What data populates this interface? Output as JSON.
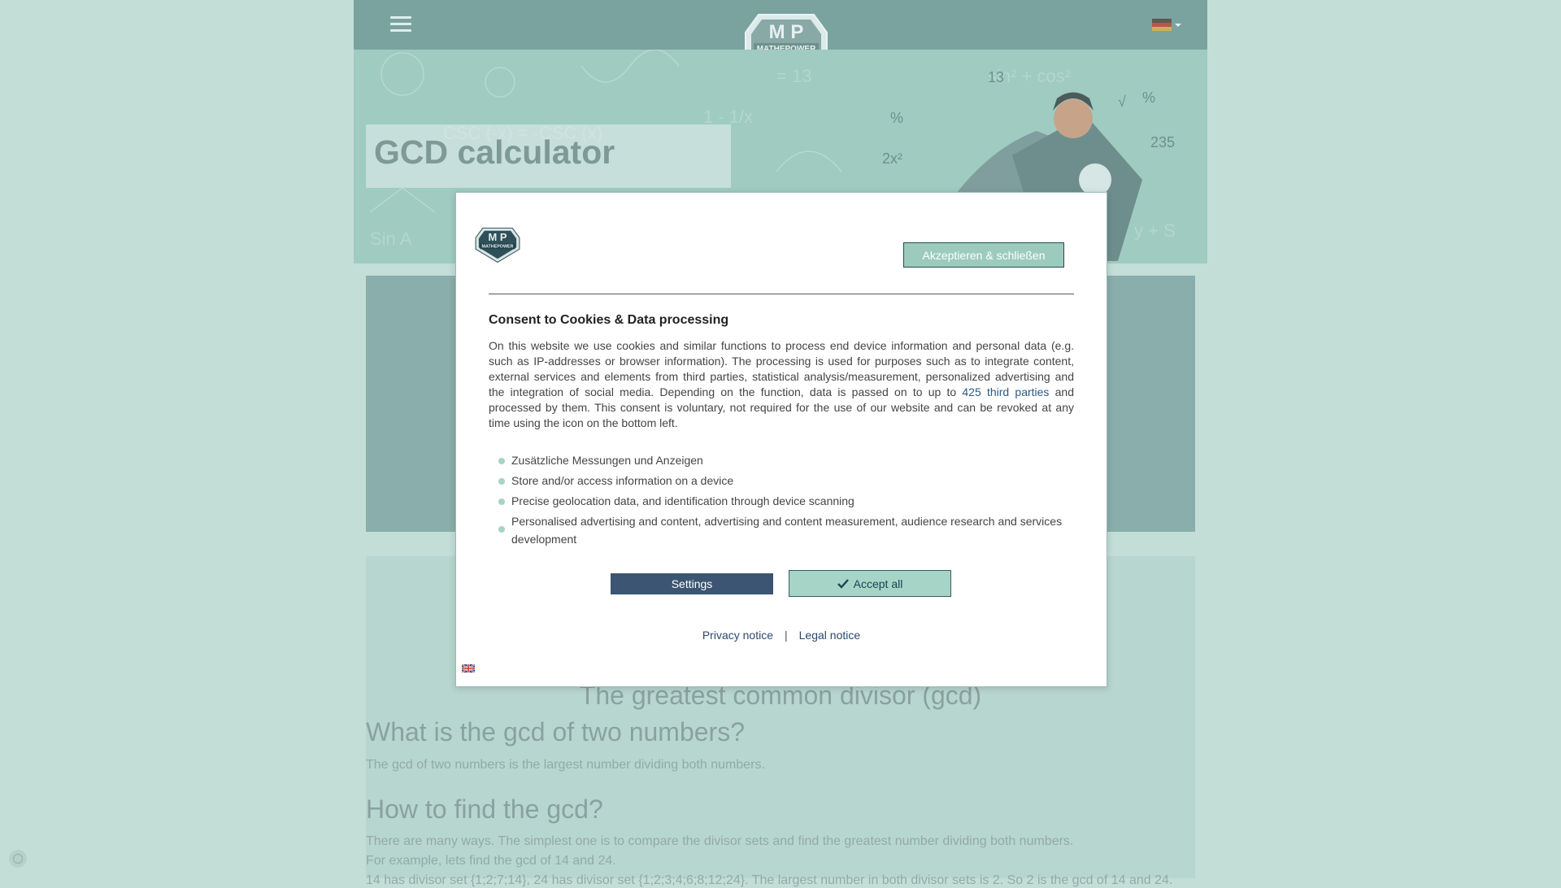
{
  "page": {
    "hero_title": "GCD calculator",
    "section_center_heading": "The greatest common divisor (gcd)",
    "what_heading": "What is the gcd of two numbers?",
    "what_text": "The gcd of two numbers is the largest number dividing both numbers.",
    "how_heading": "How to find the gcd?",
    "how_text_1": "There are many ways. The simplest one is to compare the divisor sets and find the greatest number dividing both numbers.",
    "how_text_2": "For example, lets find the gcd of 14 and 24.",
    "how_text_3": "14 has divisor set {1;2;7;14}, 24 has divisor set {1;2;3;4;6;8;12;24}. The largest number in both divisor sets is 2. So 2 is the gcd of 14 and 24."
  },
  "logo": {
    "letters": "M P",
    "word": "MATHEPOWER"
  },
  "modal": {
    "accept_close_label": "Akzeptieren & schließen",
    "title": "Consent to Cookies & Data processing",
    "text_before_link": "On this website we use cookies and similar functions to process end device information and personal data (e.g. such as IP-addresses or browser information). The processing is used for purposes such as to integrate content, external services and elements from third parties, statistical analysis/measurement, personalized advertising and the integration of social media. Depending on the function, data is passed on to up to ",
    "third_parties_link": "425 third parties",
    "text_after_link": " and processed by them. This consent is voluntary, not required for the use of our website and can be revoked at any time using the icon on the bottom left.",
    "purposes": [
      "Zusätzliche Messungen und Anzeigen",
      "Store and/or access information on a device",
      "Precise geolocation data, and identification through device scanning",
      "Personalised advertising and content, advertising and content measurement, audience research and services development"
    ],
    "settings_label": "Settings",
    "accept_all_label": "Accept all",
    "privacy_label": "Privacy notice",
    "separator": "|",
    "legal_label": "Legal notice"
  },
  "colors": {
    "background": "#c3ded7",
    "topbar": "#7aa3a0",
    "hero": "#9fcbc0",
    "settings_button": "#3b5573",
    "accept_button": "#a6d4c6"
  },
  "icons": [
    "hamburger-menu-icon",
    "mathepower-logo",
    "german-flag-icon",
    "check-icon",
    "english-flag-icon",
    "fingerprint-icon"
  ]
}
